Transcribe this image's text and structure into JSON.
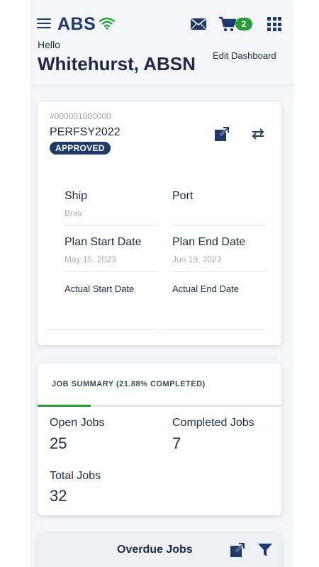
{
  "header": {
    "brand": "ABS",
    "cart_count": "2",
    "greeting": "Hello",
    "user_name": "Whitehurst, ABSN",
    "edit_dashboard": "Edit Dashboard",
    "icons": [
      "menu-icon",
      "wifi-icon",
      "mail-icon",
      "cart-icon",
      "apps-grid-icon"
    ]
  },
  "project_card": {
    "id": "#000001000000",
    "name": "PERFSY2022",
    "status": "APPROVED",
    "fields": {
      "ship_label": "Ship",
      "ship_value": "Brav",
      "port_label": "Port",
      "port_value": "",
      "plan_start_label": "Plan Start Date",
      "plan_start_value": "May 15, 2023",
      "plan_end_label": "Plan End Date",
      "plan_end_value": "Jun 19, 2023",
      "actual_start_label": "Actual Start Date",
      "actual_start_value": "",
      "actual_end_label": "Actual End Date",
      "actual_end_value": ""
    }
  },
  "job_summary": {
    "heading": "JOB SUMMARY (21.88% COMPLETED)",
    "progress_fraction": 0.2188,
    "open_label": "Open Jobs",
    "open_value": "25",
    "completed_label": "Completed Jobs",
    "completed_value": "7",
    "total_label": "Total Jobs",
    "total_value": "32"
  },
  "overdue": {
    "title": "Overdue Jobs"
  },
  "colors": {
    "primary": "#1f3a68",
    "accent_green": "#2a9d3b",
    "background": "#f4f5f8"
  }
}
